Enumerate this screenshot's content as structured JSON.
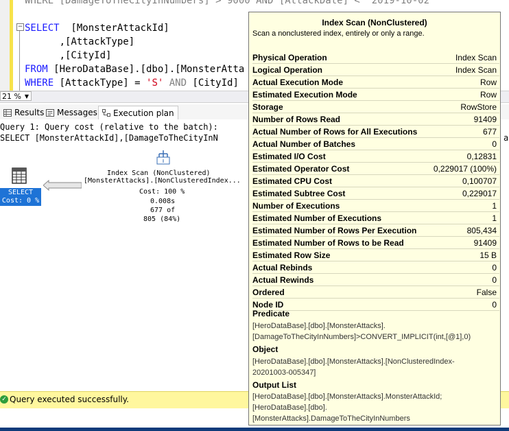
{
  "editor": {
    "line0_prefix": "WHERE [DamageToTheCityInNumbers] > 9000 AND [AttackDate] < '2019-10-02",
    "line1_kw": "SELECT",
    "line1_rest": "  [MonsterAttackId]",
    "line2": "      ,[AttackType]",
    "line3": "      ,[CityId]",
    "line4_kw": "FROM",
    "line4_rest": " [HeroDataBase].[dbo].[MonsterAtta",
    "line5_kw": "WHERE",
    "line5_mid": " [AttackType] = ",
    "line5_str": "'S'",
    "line5_and": " AND",
    "line5_rest": " [CityId]"
  },
  "zoom": {
    "value": "21 %"
  },
  "tabs": [
    {
      "label": "Results"
    },
    {
      "label": "Messages"
    },
    {
      "label": "Execution plan"
    }
  ],
  "plan": {
    "query_header": "Query 1: Query cost (relative to the batch):",
    "query_sql": "SELECT [MonsterAttackId],[DamageToTheCityInN",
    "query_sql_tail": "a",
    "select_label": "SELECT",
    "select_cost": "Cost: 0 %",
    "scan_title": "Index Scan (NonClustered)",
    "scan_object": "[MonsterAttacks].[NonClusteredIndex...",
    "scan_cost": "Cost: 100 %",
    "scan_time": "0.008s",
    "scan_rows_a": "677 of",
    "scan_rows_b": "805 (84%)"
  },
  "status": {
    "text": "Query executed successfully."
  },
  "tooltip": {
    "title": "Index Scan (NonClustered)",
    "subtitle": "Scan a nonclustered index, entirely or only a range.",
    "rows": [
      {
        "label": "Physical Operation",
        "value": "Index Scan"
      },
      {
        "label": "Logical Operation",
        "value": "Index Scan"
      },
      {
        "label": "Actual Execution Mode",
        "value": "Row"
      },
      {
        "label": "Estimated Execution Mode",
        "value": "Row"
      },
      {
        "label": "Storage",
        "value": "RowStore"
      },
      {
        "label": "Number of Rows Read",
        "value": "91409"
      },
      {
        "label": "Actual Number of Rows for All Executions",
        "value": "677"
      },
      {
        "label": "Actual Number of Batches",
        "value": "0"
      },
      {
        "label": "Estimated I/O Cost",
        "value": "0,12831"
      },
      {
        "label": "Estimated Operator Cost",
        "value": "0,229017 (100%)"
      },
      {
        "label": "Estimated CPU Cost",
        "value": "0,100707"
      },
      {
        "label": "Estimated Subtree Cost",
        "value": "0,229017"
      },
      {
        "label": "Number of Executions",
        "value": "1"
      },
      {
        "label": "Estimated Number of Executions",
        "value": "1"
      },
      {
        "label": "Estimated Number of Rows Per Execution",
        "value": "805,434"
      },
      {
        "label": "Estimated Number of Rows to be Read",
        "value": "91409"
      },
      {
        "label": "Estimated Row Size",
        "value": "15 B"
      },
      {
        "label": "Actual Rebinds",
        "value": "0"
      },
      {
        "label": "Actual Rewinds",
        "value": "0"
      },
      {
        "label": "Ordered",
        "value": "False"
      },
      {
        "label": "Node ID",
        "value": "0"
      }
    ],
    "predicate_title": "Predicate",
    "predicate_l1": "[HeroDataBase].[dbo].[MonsterAttacks].",
    "predicate_l2": "[DamageToTheCityInNumbers]>CONVERT_IMPLICIT(int,[@1],0)",
    "object_title": "Object",
    "object_l1": "[HeroDataBase].[dbo].[MonsterAttacks].[NonClusteredIndex-",
    "object_l2": "20201003-005347]",
    "output_title": "Output List",
    "output_l1": "[HeroDataBase].[dbo].[MonsterAttacks].MonsterAttackId;",
    "output_l2": "[HeroDataBase].[dbo].",
    "output_l3": "[MonsterAttacks].DamageToTheCityInNumbers"
  }
}
